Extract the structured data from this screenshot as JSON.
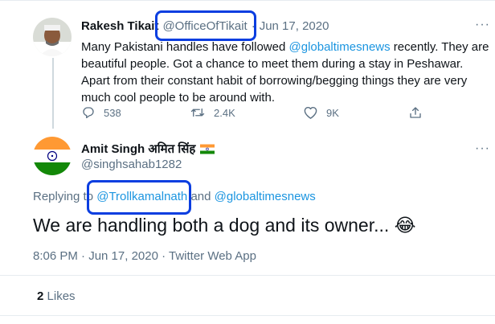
{
  "tweet1": {
    "name": "Rakesh Tikait",
    "handle": "@OfficeOfTikait",
    "dot": "·",
    "date": "Jun 17, 2020",
    "body_1": "Many Pakistani handles have followed ",
    "mention": "@globaltimesnews",
    "body_2": " recently. They are beautiful people. Got a chance to meet them during a stay in Peshawar. Apart from their constant habit of borrowing/begging things they are very much cool people to be around with.",
    "more": "···",
    "replies": "538",
    "retweets": "2.4K",
    "likes": "9K"
  },
  "tweet2": {
    "name": "Amit Singh अमित सिंह",
    "flag_emoji": "🇮🇳",
    "handle": "@singhsahab1282",
    "more": "···",
    "replying_label": "Replying to",
    "reply_mention_1": "@Trollkamalnath",
    "reply_and": "and",
    "reply_mention_2": "@globaltimesnews",
    "body": "We are handling both a dog and its owner...",
    "emoji": "😂",
    "timestamp": "8:06 PM · Jun 17, 2020 · Twitter Web App",
    "like_count": "2",
    "like_label": "Likes"
  },
  "colors": {
    "link": "#1b95e0",
    "muted": "#5b7083",
    "highlight_box": "#0b3ee0",
    "india_saffron": "#ff9933",
    "india_green": "#138808",
    "india_chakra": "#000080"
  },
  "icons": [
    "reply-icon",
    "retweet-icon",
    "like-icon",
    "share-icon",
    "more-icon"
  ]
}
